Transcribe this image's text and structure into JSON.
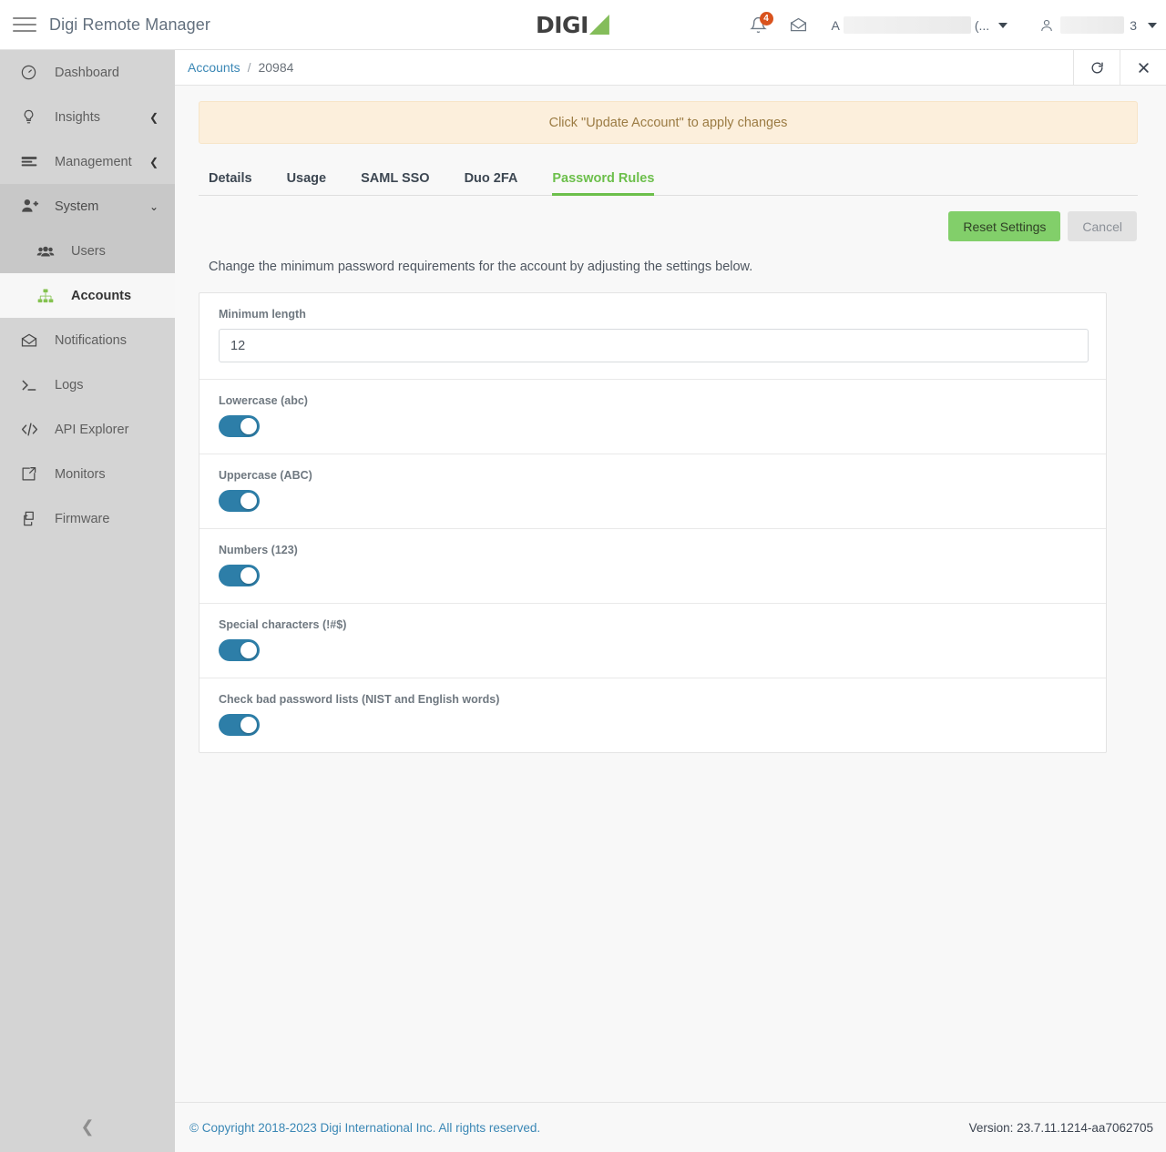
{
  "header": {
    "menu_icon": "hamburger-icon",
    "app_title": "Digi Remote Manager",
    "logo_text": "DIGI",
    "notifications": {
      "icon": "bell-icon",
      "badge_count": "4"
    },
    "messages": {
      "icon": "envelope-icon"
    },
    "account_selector": {
      "prefix": "A",
      "suffix": "(...",
      "icon": "chevron-down-icon"
    },
    "user_menu": {
      "icon": "user-icon",
      "suffix": "3",
      "chevron": "chevron-down-icon"
    }
  },
  "sidebar": {
    "items": [
      {
        "label": "Dashboard",
        "icon": "gauge-icon",
        "state": "normal",
        "chevron": ""
      },
      {
        "label": "Insights",
        "icon": "lightbulb-icon",
        "state": "normal",
        "chevron": "chevron-left-icon"
      },
      {
        "label": "Management",
        "icon": "list-icon",
        "state": "normal",
        "chevron": "chevron-left-icon"
      },
      {
        "label": "System",
        "icon": "user-add-icon",
        "state": "group-open",
        "chevron": "chevron-down-icon"
      },
      {
        "label": "Users",
        "icon": "users-icon",
        "state": "sub",
        "chevron": ""
      },
      {
        "label": "Accounts",
        "icon": "org-tree-icon",
        "state": "active",
        "chevron": ""
      },
      {
        "label": "Notifications",
        "icon": "envelope-icon",
        "state": "normal",
        "chevron": ""
      },
      {
        "label": "Logs",
        "icon": "terminal-icon",
        "state": "normal",
        "chevron": ""
      },
      {
        "label": "API Explorer",
        "icon": "code-icon",
        "state": "normal",
        "chevron": ""
      },
      {
        "label": "Monitors",
        "icon": "external-link-icon",
        "state": "normal",
        "chevron": ""
      },
      {
        "label": "Firmware",
        "icon": "layers-icon",
        "state": "normal",
        "chevron": ""
      }
    ],
    "collapse_icon": "chevron-left-icon"
  },
  "breadcrumb": {
    "parent": "Accounts",
    "separator": "/",
    "current": "20984",
    "refresh_icon": "refresh-icon",
    "close_icon": "close-icon"
  },
  "alert": {
    "message": "Click \"Update Account\" to apply changes",
    "bg_color": "#fcefdc",
    "text_color": "#9b7b43"
  },
  "tabs": [
    {
      "label": "Details",
      "active": false
    },
    {
      "label": "Usage",
      "active": false
    },
    {
      "label": "SAML SSO",
      "active": false
    },
    {
      "label": "Duo 2FA",
      "active": false
    },
    {
      "label": "Password Rules",
      "active": true
    }
  ],
  "actions": {
    "reset_label": "Reset Settings",
    "cancel_label": "Cancel",
    "reset_color": "#82cf6a",
    "cancel_disabled": true
  },
  "description": "Change the minimum password requirements for the account by adjusting the settings below.",
  "settings": {
    "min_length": {
      "label": "Minimum length",
      "value": "12",
      "placeholder": ""
    },
    "toggles": [
      {
        "label": "Lowercase (abc)",
        "on": true
      },
      {
        "label": "Uppercase (ABC)",
        "on": true
      },
      {
        "label": "Numbers (123)",
        "on": true
      },
      {
        "label": "Special characters (!#$)",
        "on": true
      },
      {
        "label": "Check bad password lists (NIST and English words)",
        "on": true
      }
    ],
    "toggle_on_color": "#2d7ea8"
  },
  "footer": {
    "copyright": "© Copyright 2018-2023 Digi International Inc. All rights reserved.",
    "version": "Version: 23.7.11.1214-aa7062705"
  }
}
